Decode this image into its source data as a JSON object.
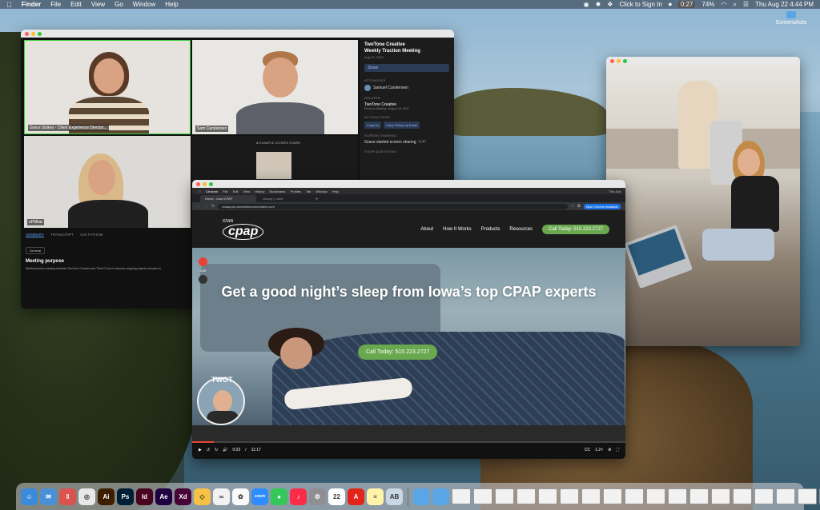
{
  "menubar": {
    "app": "Finder",
    "menus": [
      "File",
      "Edit",
      "View",
      "Go",
      "Window",
      "Help"
    ],
    "click_to_sign_in": "Click to Sign In",
    "recording_timer": "0:27",
    "battery": "74%",
    "datetime": "Thu Aug 22  4:44 PM"
  },
  "desktop": {
    "screenshots_label": "Screenshots"
  },
  "meeting": {
    "participants": [
      {
        "name": "Grace Stokes - Client Experience Director..."
      },
      {
        "name": "Sam Carstensen"
      },
      {
        "name": "ePMkar"
      }
    ],
    "screen_share_label": "● EXAMPLE SCREEN SHARE",
    "panel": {
      "title": "TwoTone Creative\nWeekly Traction Meeting",
      "date": "Aug 22, 2024",
      "share": "Share",
      "attendees_label": "ATTENDEES",
      "attendee": "Samuel Carstensen",
      "related_label": "RELATED",
      "related_item": "TwoTone Creative",
      "related_sub": "Previous Meeting • August 15, 2024",
      "action_items_label": "ACTION ITEMS",
      "copy_for": "Copy for",
      "copy_followup": "Copy Follow-up Email",
      "screen_sharing_label": "SCREEN SHARING",
      "screen_sharing_item": "Grace started screen sharing",
      "screen_sharing_time": "4:47",
      "your_questions_label": "YOUR QUESTIONS"
    },
    "tabs": [
      "SUMMARY",
      "TRANSCRIPT",
      "ASK FATHOM"
    ],
    "general": "General",
    "meeting_purpose_title": "Meeting purpose",
    "meeting_purpose_text": "Weekly traction meeting between TwoTone Creative and Third Cl sich to discuss ongoing projects and plan fo"
  },
  "browser": {
    "menu": [
      "Chrome",
      "File",
      "Edit",
      "View",
      "History",
      "Bookmarks",
      "Profiles",
      "Tab",
      "Window",
      "Help"
    ],
    "menu_right": "Thu Jun",
    "tabs": [
      "Home - Iowa CPAP",
      "Library | Loom"
    ],
    "url": "iowacpap.wearetwotonecreative.com",
    "new_chrome": "New Chrome available",
    "site": {
      "logo_top": "IOWA",
      "logo_main": "cpap",
      "nav": [
        "About",
        "How It Works",
        "Products",
        "Resources"
      ],
      "nav_cta": "Call Today: 515.223.2727",
      "hero_title": "Get a good night’s sleep from Iowa’s top CPAP experts",
      "hero_cta": "Call Today: 515.223.2727"
    },
    "rec_time": "0:00",
    "bubble_brand": "TWOT",
    "player": {
      "current": "0:22",
      "duration": "11:17",
      "speed": "1.2×",
      "progress": 0.05
    }
  },
  "dock": {
    "apps": [
      {
        "name": "finder",
        "color": "#3b8bdb",
        "glyph": "☺"
      },
      {
        "name": "mail",
        "color": "#4a90d9",
        "glyph": "✉"
      },
      {
        "name": "soundboard",
        "color": "#d9534f",
        "glyph": "‖"
      },
      {
        "name": "chrome",
        "color": "#e8e8e8",
        "glyph": "◎"
      },
      {
        "name": "illustrator",
        "color": "#3d1f00",
        "glyph": "Ai"
      },
      {
        "name": "photoshop",
        "color": "#001e36",
        "glyph": "Ps"
      },
      {
        "name": "indesign",
        "color": "#49021f",
        "glyph": "Id"
      },
      {
        "name": "after-effects",
        "color": "#1f0040",
        "glyph": "Ae"
      },
      {
        "name": "xd",
        "color": "#470137",
        "glyph": "Xd"
      },
      {
        "name": "sketch-app",
        "color": "#f7c244",
        "glyph": "◇"
      },
      {
        "name": "notes-app",
        "color": "#f2f2f2",
        "glyph": "∞"
      },
      {
        "name": "photos",
        "color": "#fafafa",
        "glyph": "✿"
      },
      {
        "name": "zoom",
        "color": "#2d8cff",
        "glyph": "zoom"
      },
      {
        "name": "messages",
        "color": "#34c759",
        "glyph": "●"
      },
      {
        "name": "music",
        "color": "#fa2d48",
        "glyph": "♪"
      },
      {
        "name": "system-settings",
        "color": "#8e8e93",
        "glyph": "⚙"
      },
      {
        "name": "calendar",
        "color": "#ffffff",
        "glyph": "22"
      },
      {
        "name": "acrobat",
        "color": "#e32418",
        "glyph": "A"
      },
      {
        "name": "notes",
        "color": "#fff3a8",
        "glyph": "≡"
      },
      {
        "name": "preview",
        "color": "#c9d6e3",
        "glyph": "AB"
      }
    ],
    "folders": 2,
    "thumbnails": 18
  }
}
